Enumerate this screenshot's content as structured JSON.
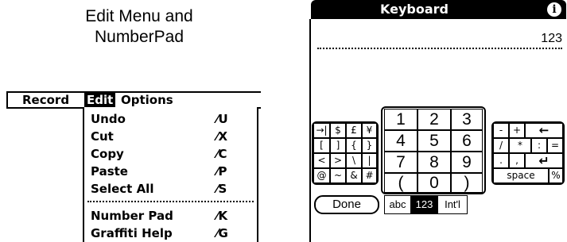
{
  "caption": {
    "line1": "Edit Menu and",
    "line2": "NumberPad"
  },
  "menubar": {
    "items": [
      "Record",
      "Edit",
      "Options"
    ]
  },
  "edit_menu": {
    "items": [
      {
        "label": "Undo",
        "shortcut": "⁄U"
      },
      {
        "label": "Cut",
        "shortcut": "⁄X"
      },
      {
        "label": "Copy",
        "shortcut": "⁄C"
      },
      {
        "label": "Paste",
        "shortcut": "⁄P"
      },
      {
        "label": "Select All",
        "shortcut": "⁄S"
      },
      {
        "label": "Number Pad",
        "shortcut": "⁄K"
      },
      {
        "label": "Graffiti Help",
        "shortcut": "⁄G"
      }
    ]
  },
  "keyboard": {
    "title": "Keyboard",
    "info_icon": "i",
    "field_value": "123",
    "left_keys": [
      [
        "→|",
        "$",
        "£",
        "¥"
      ],
      [
        "[",
        "]",
        "{",
        "}"
      ],
      [
        "<",
        ">",
        "\\",
        "|"
      ],
      [
        "@",
        "~",
        "&",
        "#"
      ]
    ],
    "numpad": [
      [
        "1",
        "2",
        "3"
      ],
      [
        "4",
        "5",
        "6"
      ],
      [
        "7",
        "8",
        "9"
      ],
      [
        "(",
        "0",
        ")"
      ]
    ],
    "right_keys": {
      "row1": [
        "-",
        "+",
        "←"
      ],
      "row2": [
        "/",
        "*",
        ":",
        "="
      ],
      "row3": [
        ".",
        ",",
        "↵"
      ],
      "row4": [
        "space",
        "%"
      ]
    },
    "done_label": "Done",
    "tabs": [
      "abc",
      "123",
      "Int'l"
    ],
    "selected_tab": "123"
  }
}
